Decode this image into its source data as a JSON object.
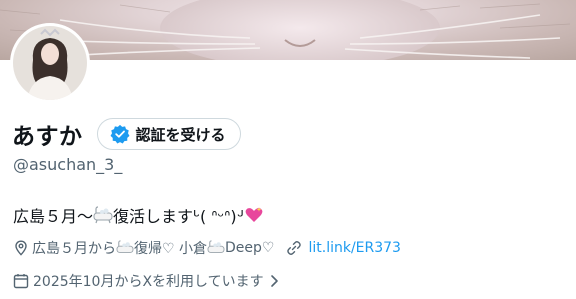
{
  "profile": {
    "display_name": "あすか",
    "verify_button_label": "認証を受ける",
    "handle": "@asuchan_3_",
    "bio_text": "広島５月〜",
    "bio_text_2": "復活しますᒡ( ᐢᵕᐢ)ᒢ",
    "location_a": "広島５月から",
    "location_b": "復帰♡ 小倉",
    "location_c": "Deep♡",
    "link": "lit.link/ER373",
    "joined": "2025年10月からXを利用しています"
  },
  "colors": {
    "accent": "#1d9bf0",
    "secondary_text": "#536471",
    "border": "#cfd9de"
  },
  "icons": {
    "verify": "verified-badge-icon",
    "location": "location-pin-icon",
    "link": "link-icon",
    "calendar": "calendar-icon",
    "chevron": "chevron-right-icon",
    "bath": "bathtub-emoji-icon",
    "heart": "sparkling-heart-emoji-icon"
  }
}
